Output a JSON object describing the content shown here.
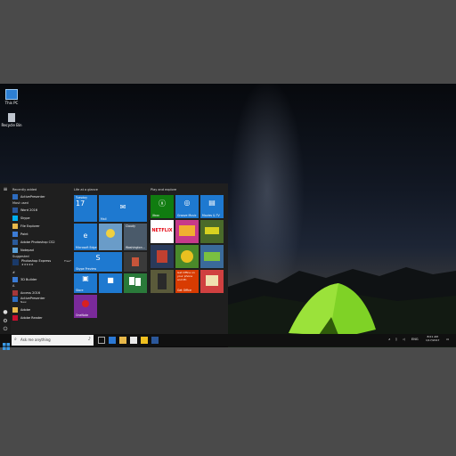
{
  "desktop": {
    "icons": [
      {
        "label": "This PC",
        "icon": "computer-icon"
      },
      {
        "label": "Recycle Bin",
        "icon": "recycle-bin-icon"
      }
    ]
  },
  "start": {
    "recently_added_header": "Recently added",
    "recently_added": [
      {
        "label": "ActivePresenter",
        "icon": "activepresenter-icon",
        "color": "#2d6cc0"
      }
    ],
    "most_used_header": "Most used",
    "most_used": [
      {
        "label": "Word 2016",
        "icon": "word-icon",
        "color": "#2b579a"
      },
      {
        "label": "Skype",
        "icon": "skype-icon",
        "color": "#00aff0"
      },
      {
        "label": "File Explorer",
        "icon": "folder-icon",
        "color": "#e8b84a"
      },
      {
        "label": "Paint",
        "icon": "paint-icon",
        "color": "#3c7bd4"
      },
      {
        "label": "Adobe Photoshop CS2",
        "icon": "photoshop-icon",
        "color": "#2a5a9a"
      },
      {
        "label": "Notepad",
        "icon": "notepad-icon",
        "color": "#5aa0d8"
      }
    ],
    "suggested_header": "Suggested",
    "suggested": {
      "label": "Photoshop Express",
      "badge": "Free*",
      "rating": "★★★★★"
    },
    "letter_hash": "#",
    "hash_apps": [
      {
        "label": "3D Builder",
        "icon": "3d-builder-icon",
        "color": "#3a7bd5"
      }
    ],
    "letter_a": "A",
    "a_apps": [
      {
        "label": "Access 2016",
        "icon": "access-icon",
        "color": "#a4373a"
      },
      {
        "label": "ActivePresenter",
        "icon": "activepresenter-icon",
        "color": "#2d6cc0"
      },
      {
        "label": "Adobe",
        "icon": "folder-icon",
        "color": "#e8b84a"
      },
      {
        "label": "Adobe Reader",
        "icon": "adobe-reader-icon",
        "color": "#c8102e"
      }
    ],
    "new_label": "New",
    "group_glance": "Life at a glance",
    "group_play": "Play and explore",
    "tiles": {
      "calendar": {
        "day": "Tuesday",
        "date": "17"
      },
      "mail": "Mail",
      "edge": "Microsoft Edge",
      "weather": {
        "condition": "Cloudy",
        "location": "Washington..."
      },
      "skype": "Skype Preview",
      "store": "Store",
      "onenote": "OneNote",
      "xbox": "Xbox",
      "groove": "Groove Music",
      "movies": "Movies & TV",
      "netflix": "NETFLIX",
      "office": "Get Office on your phone and PC",
      "getoffice": "Get Office"
    }
  },
  "taskbar": {
    "search_placeholder": "Ask me anything",
    "lang": "ENG",
    "time": "8:01 AM",
    "date": "1/17/2017"
  }
}
